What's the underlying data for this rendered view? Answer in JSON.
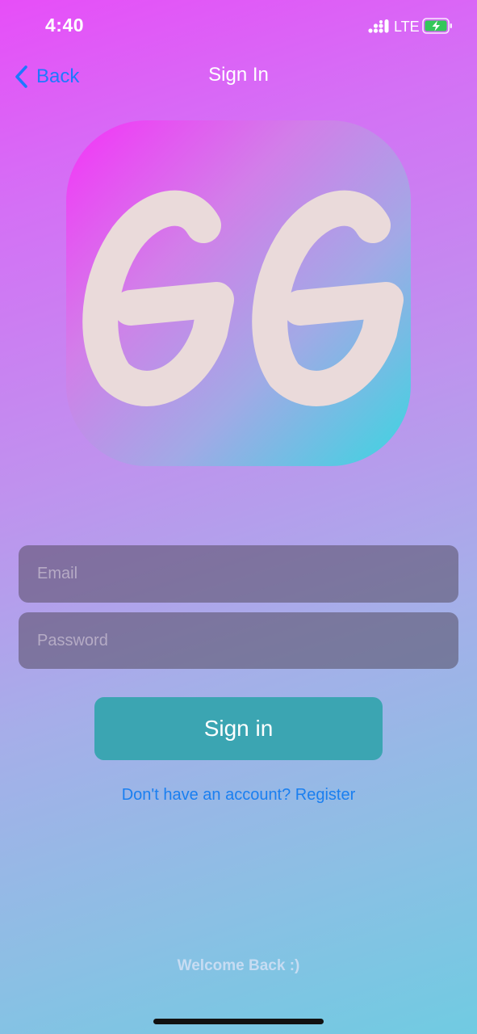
{
  "status_bar": {
    "time": "4:40",
    "network": "LTE",
    "icons": [
      "signal-icon",
      "battery-charging-icon"
    ]
  },
  "nav": {
    "back_label": "Back",
    "title": "Sign In",
    "back_icon": "chevron-left-icon"
  },
  "logo": {
    "text": "GG",
    "gradient_colors": [
      "#f433f8",
      "#d27ee9",
      "#a2a9e6",
      "#3bd5e1"
    ],
    "letter_color": "#eadada"
  },
  "form": {
    "email_placeholder": "Email",
    "email_value": "",
    "password_placeholder": "Password",
    "password_value": "",
    "submit_label": "Sign in",
    "register_link": "Don't have an account? Register"
  },
  "footer": {
    "welcome": "Welcome Back :)"
  },
  "colors": {
    "accent_link": "#1e78ff",
    "button": "#3ba5b2",
    "input_bg": "rgba(80,70,90,0.52)"
  }
}
